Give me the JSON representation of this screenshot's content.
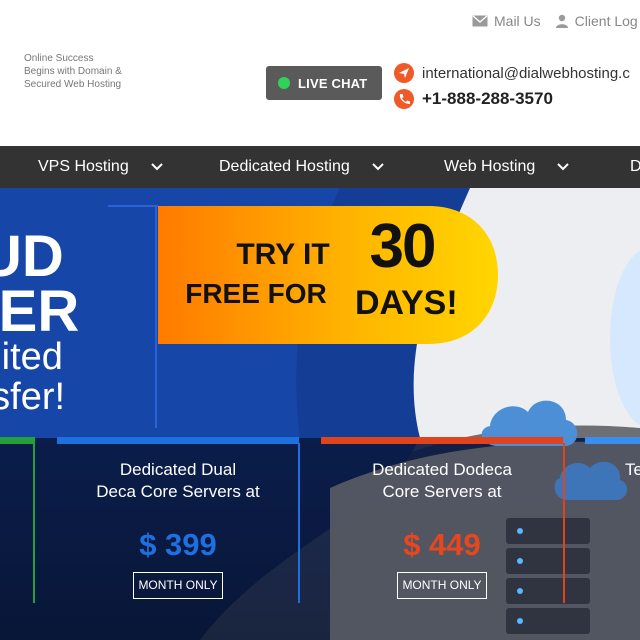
{
  "header": {
    "tagline": [
      "Online Success",
      "Begins with Domain &",
      "Secured Web Hosting"
    ],
    "top_links": {
      "mail": "Mail Us",
      "client": "Client Log"
    },
    "live_chat": "LIVE CHAT",
    "email": "international@dialwebhosting.c",
    "phone": "+1-888-288-3570"
  },
  "nav": {
    "items": [
      {
        "label": "VPS Hosting"
      },
      {
        "label": "Dedicated Hosting"
      },
      {
        "label": "Web Hosting"
      },
      {
        "label": "D"
      }
    ]
  },
  "hero": {
    "headline": [
      "UD",
      "VER",
      "mited",
      "nsfer!"
    ],
    "promo": {
      "try_it": "TRY IT",
      "free_for": "FREE FOR",
      "number": "30",
      "days": "DAYS!"
    }
  },
  "plans": [
    {
      "title_line1": "Dedicated Dual",
      "title_line2": "Deca Core Servers at",
      "price": "$ 399",
      "button": "MONTH ONLY",
      "accent": "#1e6fe0"
    },
    {
      "title_line1": "Dedicated Dodeca",
      "title_line2": "Core Servers at",
      "price": "$ 449",
      "button": "MONTH ONLY",
      "accent": "#e0441c"
    },
    {
      "title_line1": "",
      "title_line2": "Te",
      "price": "",
      "button": "",
      "accent": "#3a8ef0"
    }
  ],
  "colors": {
    "nav_bg": "#333333",
    "hero_blue": "#0f2a6b",
    "promo_orange": "#ff8a00",
    "promo_yellow": "#ffd200",
    "accent_orange": "#f05a28",
    "live_green": "#2fd35a"
  },
  "icons": [
    "mail-icon",
    "user-icon",
    "send-icon",
    "phone-icon",
    "chevron-down-icon",
    "cloud-icon",
    "server-icon"
  ]
}
